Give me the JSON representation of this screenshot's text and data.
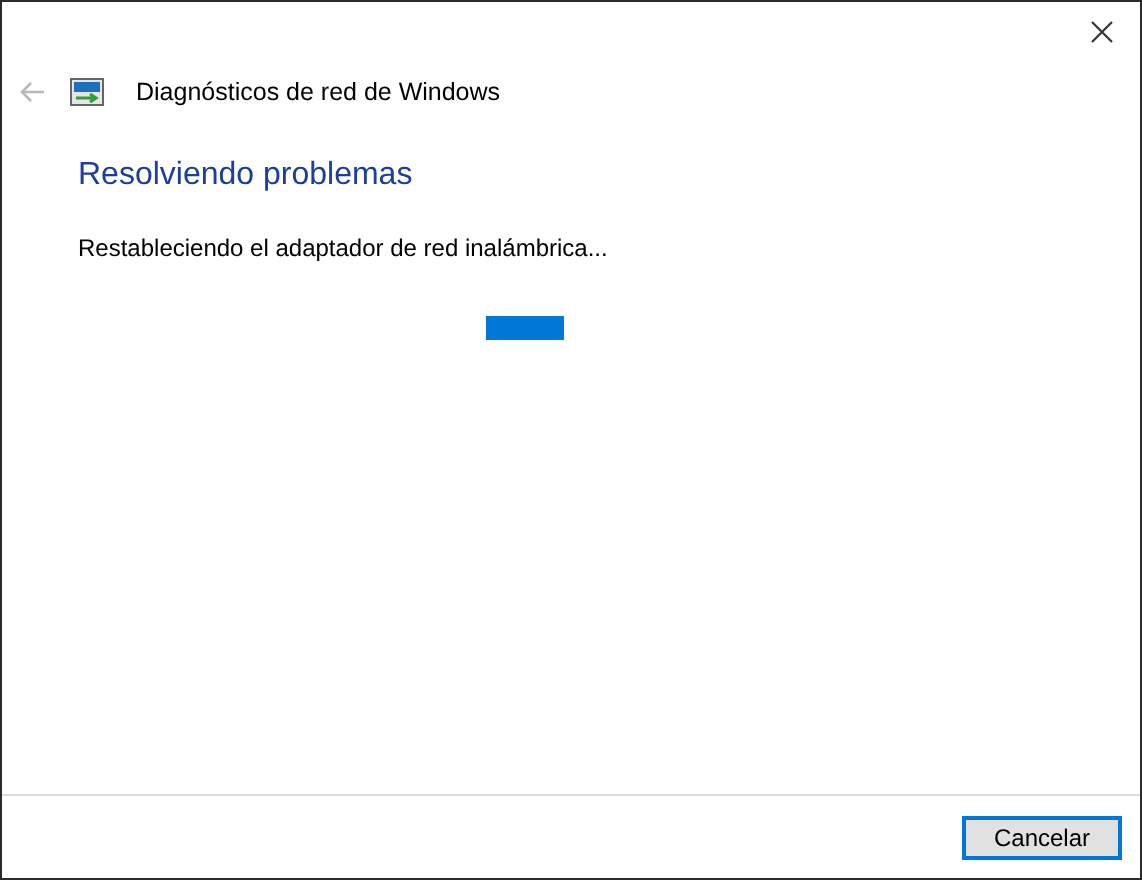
{
  "header": {
    "title": "Diagnósticos de red de Windows",
    "back_disabled": true
  },
  "heading": "Resolviendo problemas",
  "status": "Restableciendo el adaptador de red inalámbrica...",
  "buttons": [
    {
      "label": "Cancelar",
      "focused": true
    }
  ]
}
